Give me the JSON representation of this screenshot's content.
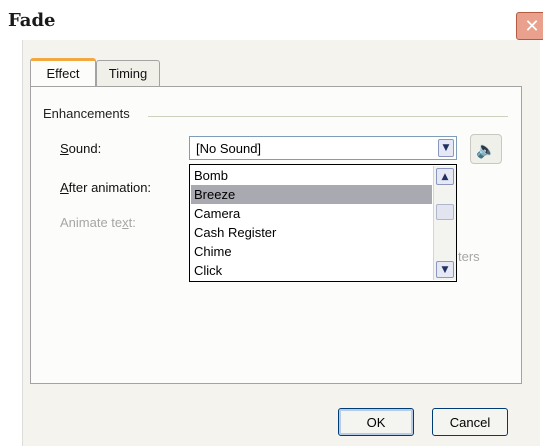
{
  "window": {
    "title": "Fade",
    "close_glyph": "✕"
  },
  "tabs": [
    {
      "label": "Effect",
      "active": true
    },
    {
      "label": "Timing",
      "active": false
    }
  ],
  "enhancements": {
    "group_label": "Enhancements",
    "sound": {
      "label": "Sound:",
      "value": "[No Sound]",
      "icon": "speaker-icon"
    },
    "after_animation": {
      "label": "After animation:"
    },
    "animate_text": {
      "label": "Animate text:",
      "enabled": false
    },
    "partial_text": "ters"
  },
  "sound_list": {
    "items": [
      "Bomb",
      "Breeze",
      "Camera",
      "Cash Register",
      "Chime",
      "Click"
    ],
    "selected": "Breeze"
  },
  "buttons": {
    "ok": "OK",
    "cancel": "Cancel"
  },
  "colors": {
    "tab_accent": "#f3a740",
    "selection": "#a9a9b1",
    "close_button": "#e9a08c",
    "button_border": "#003c74"
  },
  "glyphs": {
    "dropdown": "▼",
    "scroll_up": "▲",
    "scroll_down": "▼",
    "speaker": "🔈"
  }
}
